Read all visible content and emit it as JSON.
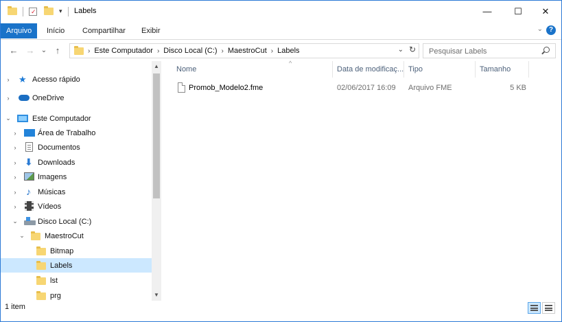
{
  "window": {
    "title": "Labels"
  },
  "window_controls": {
    "minimize": "—",
    "maximize": "☐",
    "close": "✕"
  },
  "ribbon": {
    "tabs": [
      {
        "label": "Arquivo"
      },
      {
        "label": "Início"
      },
      {
        "label": "Compartilhar"
      },
      {
        "label": "Exibir"
      }
    ],
    "help": "?",
    "collapse": "⌄"
  },
  "address": {
    "breadcrumbs": [
      "Este Computador",
      "Disco Local (C:)",
      "MaestroCut",
      "Labels"
    ],
    "separator": "›",
    "dropdown": "⌄",
    "refresh": "↻"
  },
  "search": {
    "placeholder": "Pesquisar Labels"
  },
  "nav": {
    "back": "←",
    "forward": "→",
    "recent": "⌄",
    "up": "↑",
    "items": [
      {
        "label": "Acesso rápido",
        "chevron": "›"
      },
      {
        "label": "OneDrive",
        "chevron": "›"
      },
      {
        "label": "Este Computador",
        "chevron": "⌄"
      },
      {
        "label": "Área de Trabalho",
        "chevron": "›"
      },
      {
        "label": "Documentos",
        "chevron": "›"
      },
      {
        "label": "Downloads",
        "chevron": "›"
      },
      {
        "label": "Imagens",
        "chevron": "›"
      },
      {
        "label": "Músicas",
        "chevron": "›"
      },
      {
        "label": "Vídeos",
        "chevron": "›"
      },
      {
        "label": "Disco Local (C:)",
        "chevron": "⌄"
      },
      {
        "label": "MaestroCut",
        "chevron": "⌄"
      },
      {
        "label": "Bitmap"
      },
      {
        "label": "Labels"
      },
      {
        "label": "lst"
      },
      {
        "label": "prg"
      }
    ],
    "selected": "Labels",
    "scroll_up": "▲",
    "scroll_down": "▼"
  },
  "columns": [
    {
      "label": "Nome"
    },
    {
      "label": "Data de modificaç..."
    },
    {
      "label": "Tipo"
    },
    {
      "label": "Tamanho"
    }
  ],
  "sort_indicator": "^",
  "files": [
    {
      "name": "Promob_Modelo2.fme",
      "modified": "02/06/2017 16:09",
      "type": "Arquivo FME",
      "size": "5 KB"
    }
  ],
  "status": {
    "count": "1 item"
  },
  "colors": {
    "accent": "#1a73c9",
    "selection": "#cce8ff",
    "folder": "#f7d673"
  }
}
